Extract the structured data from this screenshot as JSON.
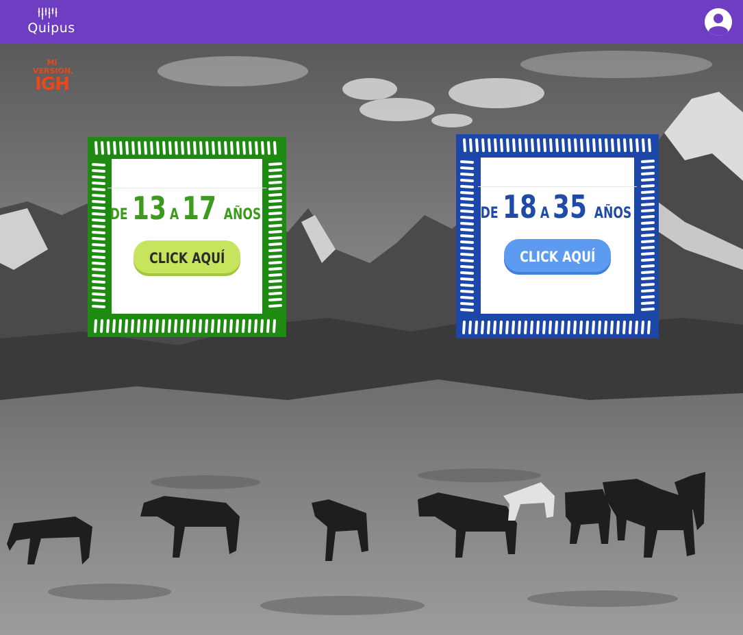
{
  "header": {
    "logo_text": "Quipus",
    "bg_color": "#6d3ec2"
  },
  "brand": {
    "line1": "MI",
    "line2": "VERSIÓN,",
    "line3": "IGH"
  },
  "cards": [
    {
      "prefix": "DE",
      "from": "13",
      "joiner": "A",
      "to": "17",
      "suffix": "AÑOS",
      "cta_label": "CLICK AQUÍ",
      "frame_color": "#1f8a12",
      "button_color": "#c7e45f"
    },
    {
      "prefix": "DE",
      "from": "18",
      "joiner": "A",
      "to": "35",
      "suffix": "AÑOS",
      "cta_label": "CLICK AQUÍ",
      "frame_color": "#1c47a8",
      "button_color": "#5c9bf0"
    }
  ],
  "icons": {
    "avatar": "account-circle-icon",
    "logo_mark": "quipu-knots-icon"
  }
}
